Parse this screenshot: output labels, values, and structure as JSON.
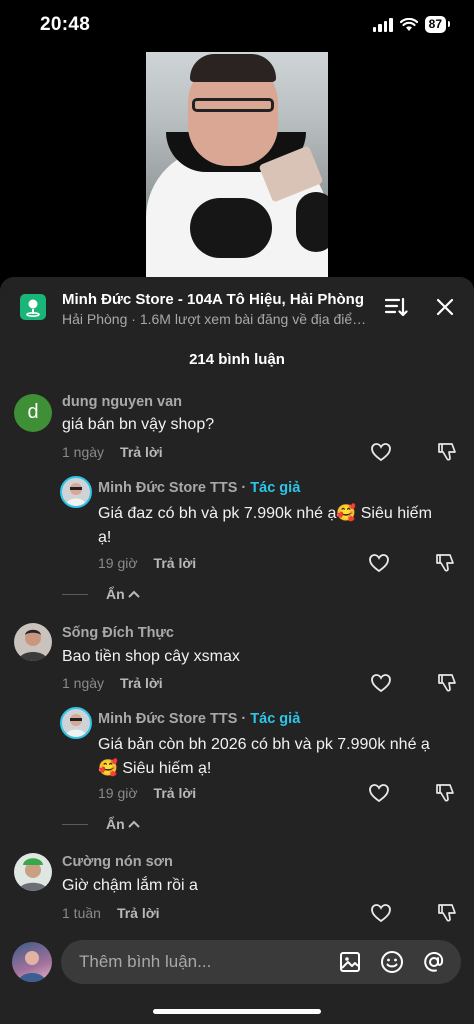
{
  "status_bar": {
    "time": "20:48",
    "battery": "87"
  },
  "header": {
    "title": "Minh Đức Store - 104A Tô Hiệu, Hải Phòng",
    "subtitle": "Hải Phòng · 1.6M lượt xem bài đăng về địa điểm này"
  },
  "comments_count": "214 bình luận",
  "comments": [
    {
      "author": "dung nguyen van",
      "avatar_letter": "d",
      "avatar_color": "#3f8f36",
      "text": "giá bán bn vậy shop?",
      "time": "1 ngày",
      "reply_label": "Trả lời",
      "reply": {
        "author": "Minh Đức Store TTS",
        "author_tag": "Tác giả",
        "text_line1": "Giá đaz có bh và pk 7.990k nhé ạ🥰 Siêu hiếm",
        "text_line2": "ạ!",
        "time": "19 giờ",
        "reply_label": "Trả lời"
      },
      "hide_label": "Ẩn"
    },
    {
      "author": "Sống Đích Thực",
      "text": "Bao tiền shop cây xsmax",
      "time": "1 ngày",
      "reply_label": "Trả lời",
      "reply": {
        "author": "Minh Đức Store TTS",
        "author_tag": "Tác giả",
        "text_line1": "Giá bản còn bh 2026 có bh và pk 7.990k nhé ạ",
        "text_line2": "🥰 Siêu hiếm ạ!",
        "time": "19 giờ",
        "reply_label": "Trả lời"
      },
      "hide_label": "Ẩn"
    },
    {
      "author": "Cường nón sơn",
      "text": "Giờ chậm lắm rồi a",
      "time": "1 tuần",
      "reply_label": "Trả lời"
    }
  ],
  "input": {
    "placeholder": "Thêm bình luận..."
  },
  "colors": {
    "accent": "#2dc5e8",
    "sheet_bg": "#232323",
    "map_logo": "#1ab578"
  },
  "icons": [
    "signal-icon",
    "wifi-icon",
    "battery-icon",
    "map-pin-icon",
    "sort-icon",
    "close-icon",
    "heart-icon",
    "dislike-icon",
    "chevron-up-icon",
    "image-icon",
    "emoji-icon",
    "mention-icon"
  ]
}
